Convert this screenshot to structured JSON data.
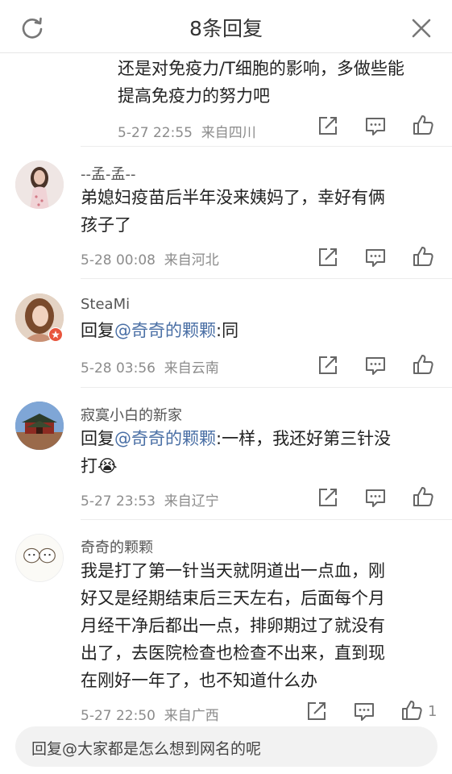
{
  "header": {
    "title": "8条回复"
  },
  "replies": [
    {
      "name": "",
      "content_lines": [
        "还是对免疫力/T细胞的影响，多做些能",
        "提高免疫力的努力吧"
      ],
      "time": "5-27 22:55",
      "location": "来自四川",
      "likes": ""
    },
    {
      "name": "--孟-孟--",
      "content_lines": [
        "弟媳妇疫苗后半年没来姨妈了，幸好有俩",
        "孩子了"
      ],
      "time": "5-28 00:08",
      "location": "来自河北",
      "likes": ""
    },
    {
      "name": "SteaMi",
      "prefix": "回复",
      "mention": "@奇奇的颗颗",
      "content_lines": [
        ":同"
      ],
      "time": "5-28 03:56",
      "location": "来自云南",
      "likes": ""
    },
    {
      "name": "寂寞小白的新家",
      "prefix": "回复",
      "mention": "@奇奇的颗颗",
      "content_lines": [
        ":一样，我还好第三针没",
        "打😭"
      ],
      "time": "5-27 23:53",
      "location": "来自辽宁",
      "likes": ""
    },
    {
      "name": "奇奇的颗颗",
      "content_lines": [
        "我是打了第一针当天就阴道出一点血，刚",
        "好又是经期结束后三天左右，后面每个月",
        "月经干净后都出一点，排卵期过了就没有",
        "出了，去医院检查也检查不出来，直到现",
        "在刚好一年了，也不知道什么办"
      ],
      "time": "5-27 22:50",
      "location": "来自广西",
      "likes": "1"
    }
  ],
  "input": {
    "placeholder": "回复@大家都是怎么想到网名的呢"
  },
  "colors": {
    "mention": "#4a6fa5",
    "meta": "#8c8c8c",
    "divider": "#ececec"
  }
}
